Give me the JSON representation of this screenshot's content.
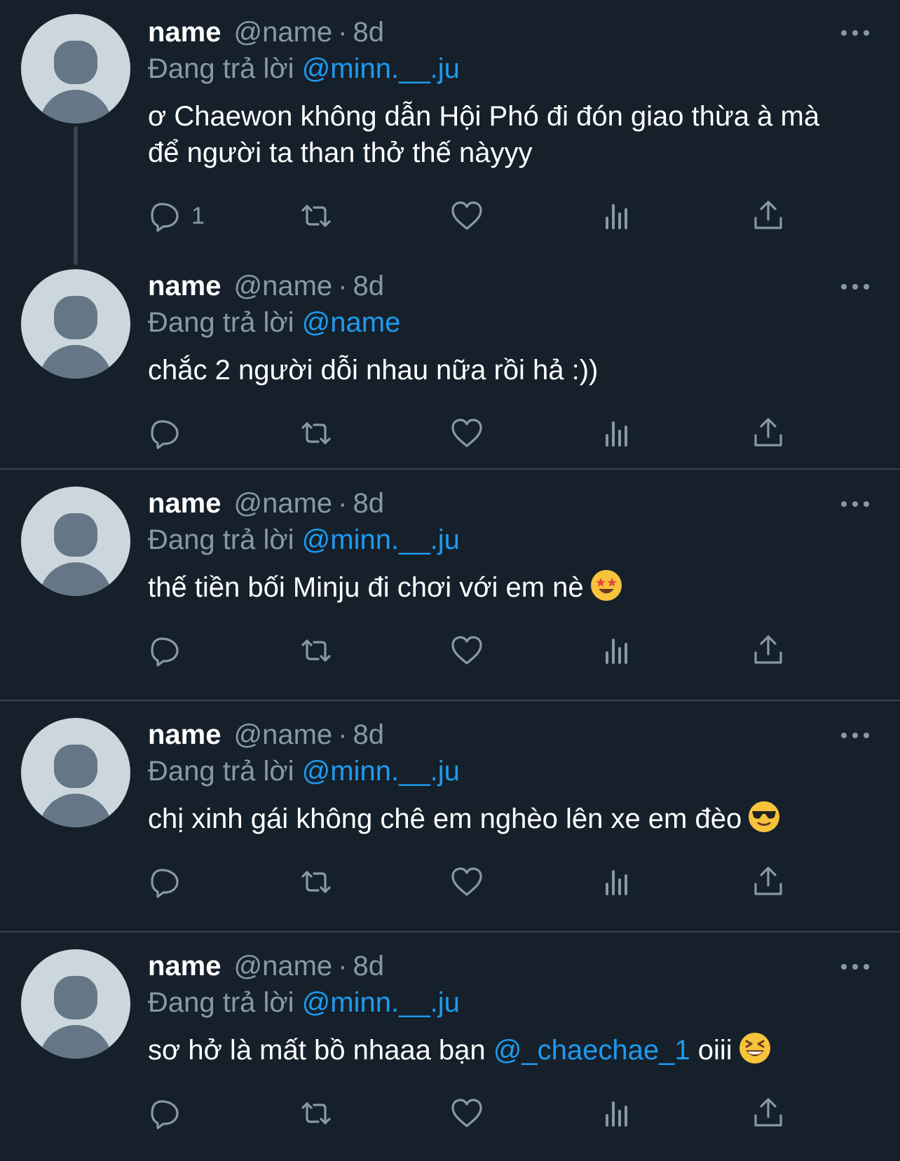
{
  "colors": {
    "background": "#15202b",
    "muted": "#8899a6",
    "mention": "#1d9bf0",
    "divider": "#38444d"
  },
  "tweets": [
    {
      "display_name": "name",
      "handle": "@name",
      "separator": "·",
      "time": "8d",
      "replying_label": "Đang trả lời",
      "replying_to": "@minn.__.ju",
      "text": "ơ Chaewon không dẫn Hội Phó đi đón giao thừa à mà để người ta than thở thế nàyyy",
      "reply_count": "1"
    },
    {
      "display_name": "name",
      "handle": "@name",
      "separator": "·",
      "time": "8d",
      "replying_label": "Đang trả lời",
      "replying_to": "@name",
      "text": "chắc 2 người dỗi nhau nữa rồi hả :))",
      "reply_count": ""
    },
    {
      "display_name": "name",
      "handle": "@name",
      "separator": "·",
      "time": "8d",
      "replying_label": "Đang trả lời",
      "replying_to": "@minn.__.ju",
      "text": "thế tiền bối Minju đi chơi với em nè",
      "emoji": "star-struck-emoji",
      "reply_count": ""
    },
    {
      "display_name": "name",
      "handle": "@name",
      "separator": "·",
      "time": "8d",
      "replying_label": "Đang trả lời",
      "replying_to": "@minn.__.ju",
      "text": "chị xinh gái không chê em nghèo lên xe em đèo",
      "emoji": "sunglasses-emoji",
      "reply_count": ""
    },
    {
      "display_name": "name",
      "handle": "@name",
      "separator": "·",
      "time": "8d",
      "replying_label": "Đang trả lời",
      "replying_to": "@minn.__.ju",
      "text_before": "sơ hở là mất bồ nhaaa bạn",
      "text_mention": "@_chaechae_1",
      "text_after": "oiii",
      "emoji": "grinning-squinting-emoji",
      "reply_count": ""
    }
  ],
  "icons": [
    "reply-icon",
    "retweet-icon",
    "like-icon",
    "views-icon",
    "share-icon",
    "more-icon"
  ]
}
